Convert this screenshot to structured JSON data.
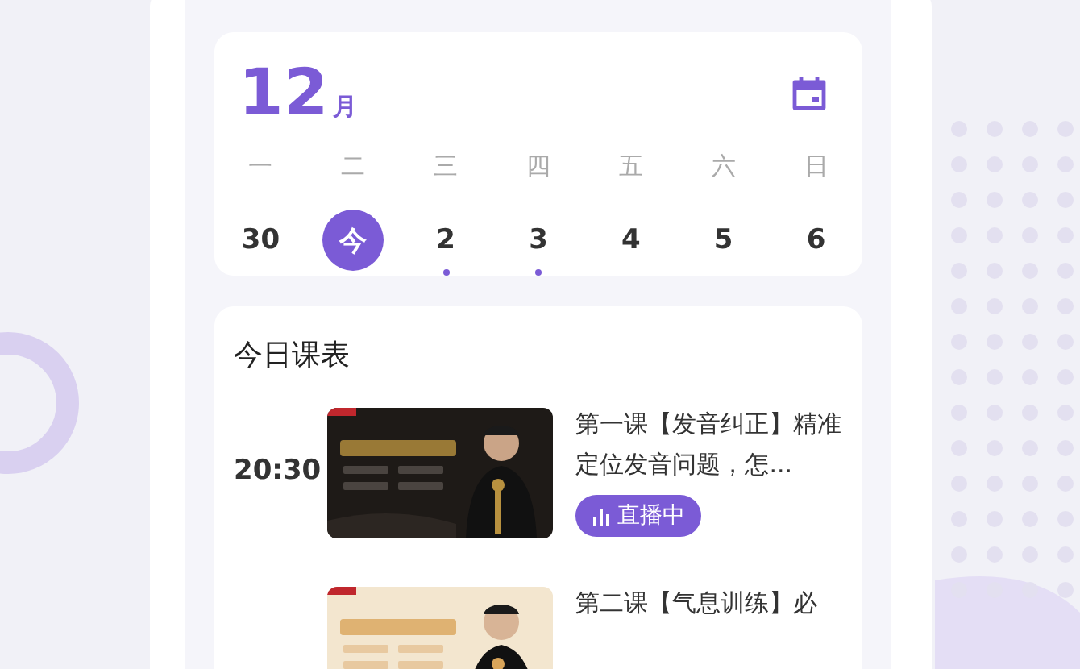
{
  "calendar": {
    "month": "12",
    "month_unit": "月",
    "weekdays": [
      "一",
      "二",
      "三",
      "四",
      "五",
      "六",
      "日"
    ],
    "days": [
      {
        "label": "30",
        "selected": false,
        "has_course": false
      },
      {
        "label": "今",
        "selected": true,
        "has_course": false
      },
      {
        "label": "2",
        "selected": false,
        "has_course": true
      },
      {
        "label": "3",
        "selected": false,
        "has_course": true
      },
      {
        "label": "4",
        "selected": false,
        "has_course": false
      },
      {
        "label": "5",
        "selected": false,
        "has_course": false
      },
      {
        "label": "6",
        "selected": false,
        "has_course": false
      }
    ]
  },
  "schedule": {
    "title": "今日课表",
    "lessons": [
      {
        "time": "20:30",
        "title": "第一课【发音纠正】精准定位发音问题，怎...",
        "status": "直播中"
      },
      {
        "title": "第二课【气息训练】必"
      }
    ]
  }
}
